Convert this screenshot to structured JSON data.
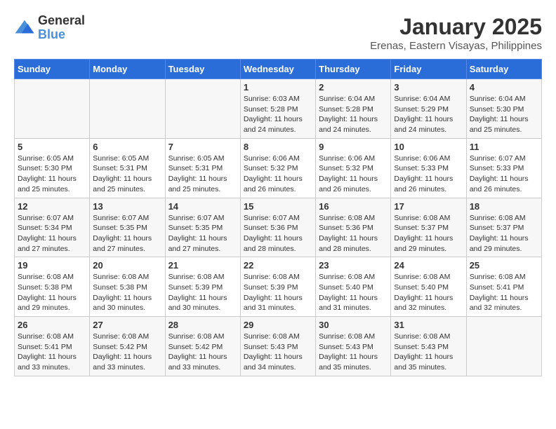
{
  "header": {
    "logo": {
      "general": "General",
      "blue": "Blue"
    },
    "title": "January 2025",
    "subtitle": "Erenas, Eastern Visayas, Philippines"
  },
  "weekdays": [
    "Sunday",
    "Monday",
    "Tuesday",
    "Wednesday",
    "Thursday",
    "Friday",
    "Saturday"
  ],
  "weeks": [
    [
      {
        "day": "",
        "info": ""
      },
      {
        "day": "",
        "info": ""
      },
      {
        "day": "",
        "info": ""
      },
      {
        "day": "1",
        "info": "Sunrise: 6:03 AM\nSunset: 5:28 PM\nDaylight: 11 hours and 24 minutes."
      },
      {
        "day": "2",
        "info": "Sunrise: 6:04 AM\nSunset: 5:28 PM\nDaylight: 11 hours and 24 minutes."
      },
      {
        "day": "3",
        "info": "Sunrise: 6:04 AM\nSunset: 5:29 PM\nDaylight: 11 hours and 24 minutes."
      },
      {
        "day": "4",
        "info": "Sunrise: 6:04 AM\nSunset: 5:30 PM\nDaylight: 11 hours and 25 minutes."
      }
    ],
    [
      {
        "day": "5",
        "info": "Sunrise: 6:05 AM\nSunset: 5:30 PM\nDaylight: 11 hours and 25 minutes."
      },
      {
        "day": "6",
        "info": "Sunrise: 6:05 AM\nSunset: 5:31 PM\nDaylight: 11 hours and 25 minutes."
      },
      {
        "day": "7",
        "info": "Sunrise: 6:05 AM\nSunset: 5:31 PM\nDaylight: 11 hours and 25 minutes."
      },
      {
        "day": "8",
        "info": "Sunrise: 6:06 AM\nSunset: 5:32 PM\nDaylight: 11 hours and 26 minutes."
      },
      {
        "day": "9",
        "info": "Sunrise: 6:06 AM\nSunset: 5:32 PM\nDaylight: 11 hours and 26 minutes."
      },
      {
        "day": "10",
        "info": "Sunrise: 6:06 AM\nSunset: 5:33 PM\nDaylight: 11 hours and 26 minutes."
      },
      {
        "day": "11",
        "info": "Sunrise: 6:07 AM\nSunset: 5:33 PM\nDaylight: 11 hours and 26 minutes."
      }
    ],
    [
      {
        "day": "12",
        "info": "Sunrise: 6:07 AM\nSunset: 5:34 PM\nDaylight: 11 hours and 27 minutes."
      },
      {
        "day": "13",
        "info": "Sunrise: 6:07 AM\nSunset: 5:35 PM\nDaylight: 11 hours and 27 minutes."
      },
      {
        "day": "14",
        "info": "Sunrise: 6:07 AM\nSunset: 5:35 PM\nDaylight: 11 hours and 27 minutes."
      },
      {
        "day": "15",
        "info": "Sunrise: 6:07 AM\nSunset: 5:36 PM\nDaylight: 11 hours and 28 minutes."
      },
      {
        "day": "16",
        "info": "Sunrise: 6:08 AM\nSunset: 5:36 PM\nDaylight: 11 hours and 28 minutes."
      },
      {
        "day": "17",
        "info": "Sunrise: 6:08 AM\nSunset: 5:37 PM\nDaylight: 11 hours and 29 minutes."
      },
      {
        "day": "18",
        "info": "Sunrise: 6:08 AM\nSunset: 5:37 PM\nDaylight: 11 hours and 29 minutes."
      }
    ],
    [
      {
        "day": "19",
        "info": "Sunrise: 6:08 AM\nSunset: 5:38 PM\nDaylight: 11 hours and 29 minutes."
      },
      {
        "day": "20",
        "info": "Sunrise: 6:08 AM\nSunset: 5:38 PM\nDaylight: 11 hours and 30 minutes."
      },
      {
        "day": "21",
        "info": "Sunrise: 6:08 AM\nSunset: 5:39 PM\nDaylight: 11 hours and 30 minutes."
      },
      {
        "day": "22",
        "info": "Sunrise: 6:08 AM\nSunset: 5:39 PM\nDaylight: 11 hours and 31 minutes."
      },
      {
        "day": "23",
        "info": "Sunrise: 6:08 AM\nSunset: 5:40 PM\nDaylight: 11 hours and 31 minutes."
      },
      {
        "day": "24",
        "info": "Sunrise: 6:08 AM\nSunset: 5:40 PM\nDaylight: 11 hours and 32 minutes."
      },
      {
        "day": "25",
        "info": "Sunrise: 6:08 AM\nSunset: 5:41 PM\nDaylight: 11 hours and 32 minutes."
      }
    ],
    [
      {
        "day": "26",
        "info": "Sunrise: 6:08 AM\nSunset: 5:41 PM\nDaylight: 11 hours and 33 minutes."
      },
      {
        "day": "27",
        "info": "Sunrise: 6:08 AM\nSunset: 5:42 PM\nDaylight: 11 hours and 33 minutes."
      },
      {
        "day": "28",
        "info": "Sunrise: 6:08 AM\nSunset: 5:42 PM\nDaylight: 11 hours and 33 minutes."
      },
      {
        "day": "29",
        "info": "Sunrise: 6:08 AM\nSunset: 5:43 PM\nDaylight: 11 hours and 34 minutes."
      },
      {
        "day": "30",
        "info": "Sunrise: 6:08 AM\nSunset: 5:43 PM\nDaylight: 11 hours and 35 minutes."
      },
      {
        "day": "31",
        "info": "Sunrise: 6:08 AM\nSunset: 5:43 PM\nDaylight: 11 hours and 35 minutes."
      },
      {
        "day": "",
        "info": ""
      }
    ]
  ]
}
